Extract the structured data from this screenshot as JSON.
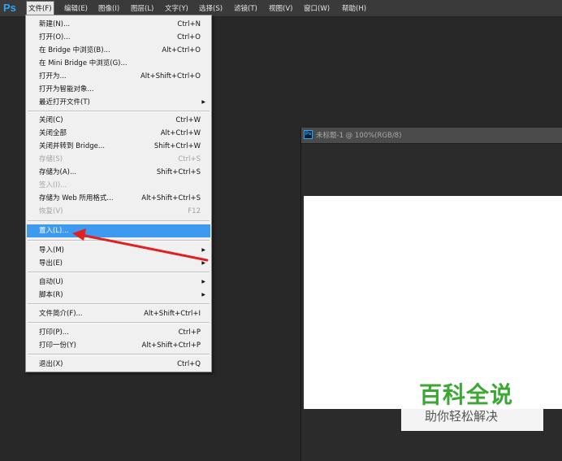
{
  "menubar": {
    "logo": "Ps",
    "items": [
      "文件(F)",
      "编辑(E)",
      "图像(I)",
      "图层(L)",
      "文字(Y)",
      "选择(S)",
      "滤镜(T)",
      "视图(V)",
      "窗口(W)",
      "帮助(H)"
    ]
  },
  "file_menu": {
    "items": [
      {
        "label": "新建(N)...",
        "shortcut": "Ctrl+N"
      },
      {
        "label": "打开(O)...",
        "shortcut": "Ctrl+O"
      },
      {
        "label": "在 Bridge 中浏览(B)...",
        "shortcut": "Alt+Ctrl+O"
      },
      {
        "label": "在 Mini Bridge 中浏览(G)...",
        "shortcut": ""
      },
      {
        "label": "打开为...",
        "shortcut": "Alt+Shift+Ctrl+O"
      },
      {
        "label": "打开为智能对象...",
        "shortcut": ""
      },
      {
        "label": "最近打开文件(T)",
        "shortcut": ""
      },
      {
        "label": "关闭(C)",
        "shortcut": "Ctrl+W"
      },
      {
        "label": "关闭全部",
        "shortcut": "Alt+Ctrl+W"
      },
      {
        "label": "关闭并转到 Bridge...",
        "shortcut": "Shift+Ctrl+W"
      },
      {
        "label": "存储(S)",
        "shortcut": "Ctrl+S"
      },
      {
        "label": "存储为(A)...",
        "shortcut": "Shift+Ctrl+S"
      },
      {
        "label": "签入(I)...",
        "shortcut": ""
      },
      {
        "label": "存储为 Web 所用格式...",
        "shortcut": "Alt+Shift+Ctrl+S"
      },
      {
        "label": "恢复(V)",
        "shortcut": "F12"
      },
      {
        "label": "置入(L)...",
        "shortcut": ""
      },
      {
        "label": "导入(M)",
        "shortcut": ""
      },
      {
        "label": "导出(E)",
        "shortcut": ""
      },
      {
        "label": "自动(U)",
        "shortcut": ""
      },
      {
        "label": "脚本(R)",
        "shortcut": ""
      },
      {
        "label": "文件简介(F)...",
        "shortcut": "Alt+Shift+Ctrl+I"
      },
      {
        "label": "打印(P)...",
        "shortcut": "Ctrl+P"
      },
      {
        "label": "打印一份(Y)",
        "shortcut": "Alt+Shift+Ctrl+P"
      },
      {
        "label": "退出(X)",
        "shortcut": "Ctrl+Q"
      }
    ]
  },
  "document": {
    "tab_icon": "Ps",
    "title": "未标题-1 @ 100%(RGB/8)"
  },
  "watermark": {
    "title": "百科全说",
    "subtitle": "助你轻松解决"
  },
  "colors": {
    "highlight": "#3e9aef",
    "annotation_arrow": "#e02020",
    "ps_blue": "#2fa4f5",
    "watermark_green": "#3aa832"
  }
}
